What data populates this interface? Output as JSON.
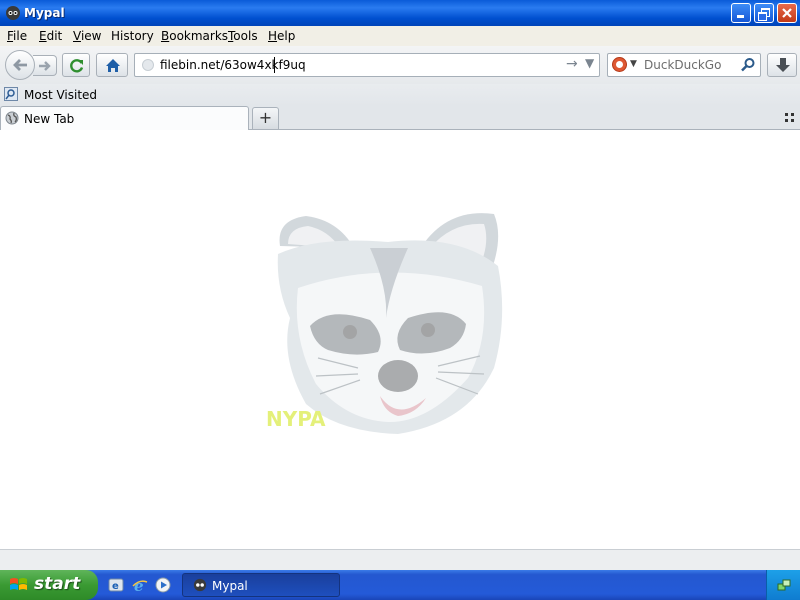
{
  "window": {
    "title": "Mypal",
    "icons": {
      "app": "mypal-icon",
      "minimize": "minimize-icon",
      "maximize": "restore-icon",
      "close": "close-icon"
    }
  },
  "menu": {
    "items": [
      {
        "first": "F",
        "rest": "ile"
      },
      {
        "first": "E",
        "rest": "dit"
      },
      {
        "first": "V",
        "rest": "iew"
      },
      {
        "first": "",
        "underlined": "s",
        "label": "History"
      },
      {
        "first": "B",
        "rest": "ookmarks"
      },
      {
        "first": "T",
        "rest": "ools"
      },
      {
        "first": "H",
        "rest": "elp"
      }
    ]
  },
  "nav": {
    "url": "filebin.net/63ow4xkf9uq",
    "search_placeholder": "DuckDuckGo",
    "icons": [
      "back-arrow-icon",
      "forward-arrow-icon",
      "reload-icon",
      "home-icon",
      "globe-icon",
      "go-arrow-icon",
      "dropdown-icon",
      "duckduckgo-icon",
      "search-icon",
      "download-icon"
    ]
  },
  "bookmarks": {
    "most_visited": "Most Visited"
  },
  "tabs": [
    {
      "label": "New Tab"
    }
  ],
  "content": {
    "image": "raccoon-face-image",
    "watermark": "NYPA"
  },
  "taskbar": {
    "start_label": "start",
    "quick_launch": [
      "ie-settings-icon",
      "internet-explorer-icon",
      "media-player-icon"
    ],
    "task": {
      "label": "Mypal"
    },
    "tray_icon": "network-icon"
  },
  "colors": {
    "titlebar": "#0a5bd8",
    "taskbar": "#245ad8",
    "start": "#3a9a33"
  }
}
